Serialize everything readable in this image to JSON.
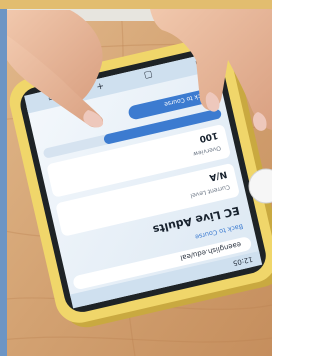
{
  "photo": {
    "subject": "Smartphone in a yellow case on a wooden table, showing a web page, with a hand pointing at the screen",
    "colors": {
      "wood": "#d7a877",
      "wood_dark": "#b97f4f",
      "wall": "#e7e5df",
      "header_strip": "#e2bd6f",
      "left_edge": "#6d95c4",
      "case": "#f0d66a",
      "case_shadow": "#c9a940",
      "bezel": "#1e2326",
      "screen_bg": "#e9f0f7",
      "screen_header": "#cfe0ef",
      "accent": "#3c7bd0",
      "skin": "#e9b89a",
      "nail": "#eec8bc",
      "fab": "#f6f6f6"
    }
  },
  "screen": {
    "status_time": "12:05",
    "url": "eaenglish.edu/eal",
    "back_link": "Back to Course",
    "page_title": "EC Live Adults",
    "rows": [
      {
        "label": "Current Level",
        "value": "N/A"
      },
      {
        "label": "Overview",
        "value": "100"
      },
      {
        "label": "Back to Course",
        "value": ""
      }
    ]
  }
}
